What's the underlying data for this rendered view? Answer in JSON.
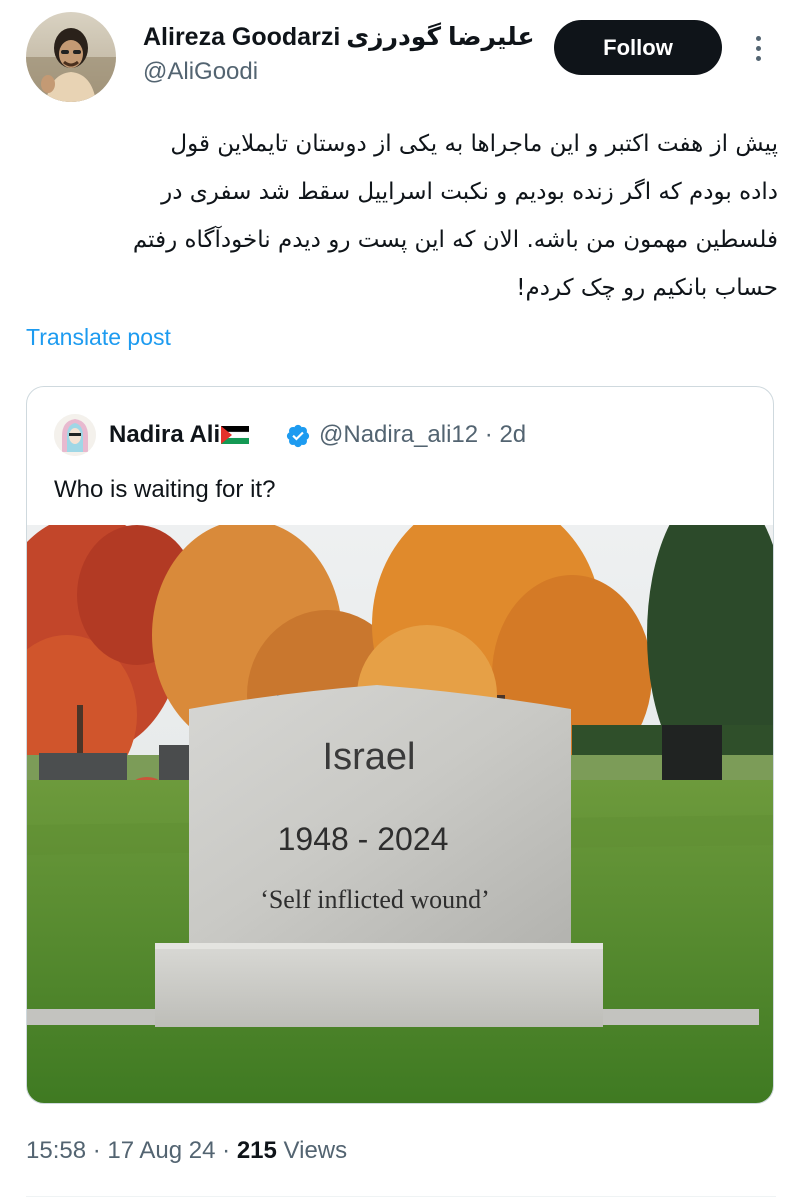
{
  "author": {
    "name": "Alireza Goodarzi",
    "name_fa": "علیرضا گودرزی",
    "handle": "@AliGoodi"
  },
  "follow_label": "Follow",
  "tweet": {
    "lines": [
      "پیش از هفت اکتبر و این ماجراها به یکی از دوستان تایملاین قول",
      "داده بودم که اگر زنده بودیم و نکبت اسراییل سقط شد سفری در",
      "فلسطین مهمون من باشه. الان که این پست رو دیدم ناخودآگاه رفتم",
      "حساب بانکیم رو چک کردم!"
    ]
  },
  "translate_label": "Translate post",
  "quoted": {
    "name": "Nadira Ali",
    "handle": "@Nadira_ali12",
    "time": "· 2d",
    "text": "Who is waiting for it?",
    "image": {
      "stone_title": "Israel",
      "stone_years": "1948 - 2024",
      "stone_quote": "‘Self inflicted wound’"
    }
  },
  "meta": {
    "time": "15:58 · 17 Aug 24 · ",
    "views_count": "215",
    "views_label": " Views"
  },
  "colors": {
    "accent": "#1d9bf0",
    "text": "#0f1419",
    "secondary": "#536471",
    "follow_bg": "#0f1419"
  },
  "icons": {
    "verified": "verified-badge-icon",
    "more": "more-dots-icon",
    "flag": "palestine-flag-icon"
  }
}
